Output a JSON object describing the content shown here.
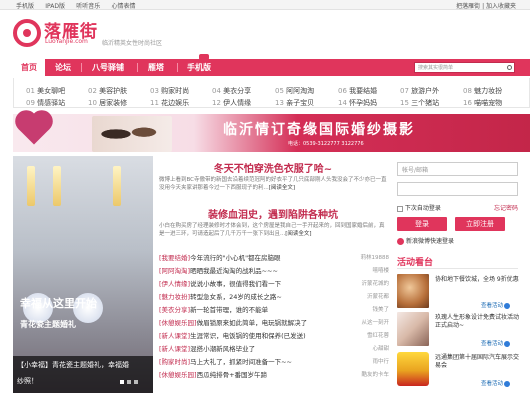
{
  "topbar": {
    "links": [
      "手机版",
      "IPAD版",
      "听听音乐",
      "心情表情"
    ],
    "right": "把落雁街 | 加入收藏夹"
  },
  "logo": {
    "cn": "落雁街",
    "en": "LuoYanJie.com",
    "sub": "临沂精英女性时尚社区"
  },
  "nav": {
    "items": [
      "首页",
      "论坛",
      "八号驿铺",
      "雁塔",
      "手机版"
    ]
  },
  "search": {
    "placeholder": "搜索其实很简单"
  },
  "subnav": {
    "row1": [
      [
        "01",
        "美女聊吧"
      ],
      [
        "02",
        "美容护肤"
      ],
      [
        "03",
        "购家时尚"
      ],
      [
        "04",
        "美衣分享"
      ],
      [
        "05",
        "阿阿淘淘"
      ],
      [
        "06",
        "我要结婚"
      ],
      [
        "07",
        "旅游户外"
      ],
      [
        "08",
        "魅力妆扮"
      ]
    ],
    "row2": [
      [
        "09",
        "情感驿站"
      ],
      [
        "10",
        "居家装修"
      ],
      [
        "11",
        "花边娱乐"
      ],
      [
        "12",
        "伊人情缘"
      ],
      [
        "13",
        "亲子宝贝"
      ],
      [
        "14",
        "怀孕妈妈"
      ],
      [
        "15",
        "三个猪站"
      ],
      [
        "16",
        "喵喵宠物"
      ]
    ]
  },
  "banner": {
    "title": "临沂情订奇缘国际婚纱摄影",
    "tel": "电话：0539-3122777 3122776"
  },
  "hero": {
    "caption": "幸福从这里开始",
    "sub": "青花瓷主题婚礼",
    "bar1": "【小幸福】青花瓷主题婚礼，幸福婚",
    "bar2": "纱照！"
  },
  "headline1": {
    "title": "冬天不怕穿洗色衣服了哈~",
    "summary": "微博上看到BC寺傲带的新国去沿着续范冠阿的好衣平了几只底部刚人头我没会了不少亦已一直没用今天夹家讲那着今过一下西服现子的利...",
    "link": "[阅读全文]"
  },
  "headline2": {
    "title": "装修血泪史，遇到陷阱各种坑",
    "summary": "小白在购买房了经理装修时才体会到，这个房屋是我自己一手开起来的，回到国家婚后前，真是一进三环，可请造起后了几千万千一张下到出且...",
    "link": "[阅读全文]"
  },
  "list": [
    {
      "cat": "[我要结婚]",
      "title": "今年流行的\"小心机\"都在房脑眼",
      "author": "莉林19888"
    },
    {
      "cat": "[阿阿淘淘]",
      "title": "晒晒我最近淘淘的战利品~~~",
      "author": "嘻嘻楼"
    },
    {
      "cat": "[伊人情缘]",
      "title": "说说小故事，很值得我们看一下",
      "author": "沂蒙花城的"
    },
    {
      "cat": "[魅力妆扮]",
      "title": "转型急女系，24岁的成长之路~",
      "author": "沂蒙花都"
    },
    {
      "cat": "[美衣分享]",
      "title": "新一轮首带理，谁的不能单",
      "author": "钱美了"
    },
    {
      "cat": "[休憩娱乐园]",
      "title": "做眉锁原来如此简单，电玩锅就解决了",
      "author": "从这一刻开"
    },
    {
      "cat": "[新人课堂]",
      "title": "生涯常识，电饭锅的使用和保养(已发送)",
      "author": "雪红花蓉"
    },
    {
      "cat": "[新人课堂]",
      "title": "混搭小潮新风格毕业了",
      "author": "心甜甜"
    },
    {
      "cat": "[购家时尚]",
      "title": "马上大礼了，抓紧时间准备一下~~",
      "author": "雨中行"
    },
    {
      "cat": "[休憩娱乐园]",
      "title": "西瓜纯排骨+番国岁午蹄",
      "author": "酷友的卡车"
    }
  ],
  "login": {
    "user": "帐号/邮箱",
    "pass": "",
    "remember": "下次自动登录",
    "forgot": "忘记密码",
    "login_btn": "登录",
    "reg_btn": "立即注册",
    "sina": "新浪微博快速登录"
  },
  "activities": {
    "title": "活动看台",
    "items": [
      {
        "text": "协和地下餐饮城，全场 9折优惠",
        "more": "查看活动"
      },
      {
        "text": "玖瑰人生形象设计免费试妆活动正式启动~",
        "more": "查看活动"
      },
      {
        "text": "远通集团第十届国际汽车展示交易会",
        "more": "查看活动"
      }
    ]
  }
}
